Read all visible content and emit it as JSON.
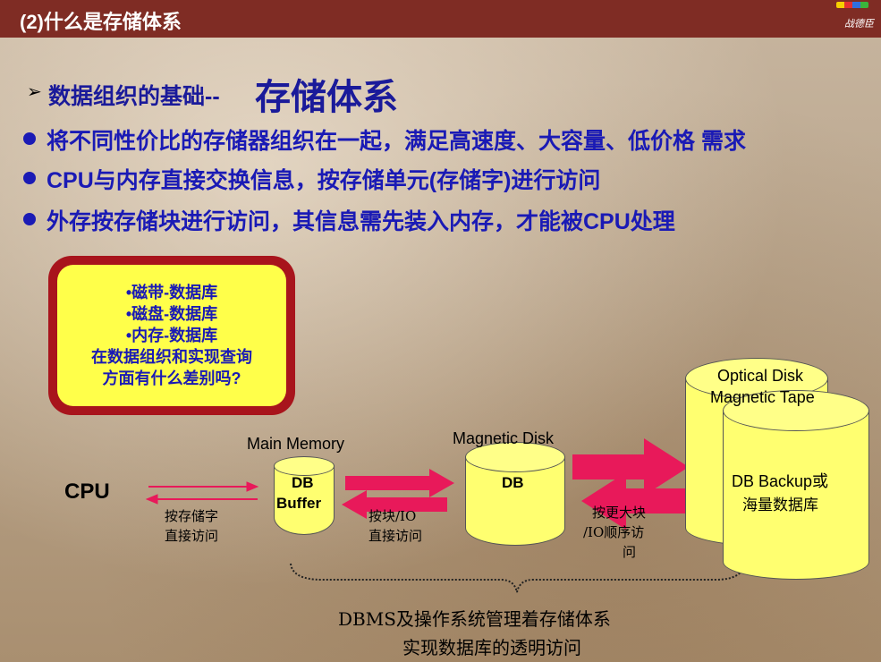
{
  "header": {
    "title": "(2)什么是存储体系",
    "logo_text": "战德臣"
  },
  "subtitle": {
    "prefix": "数据组织的基础--",
    "emphasis": "存储体系"
  },
  "bullets": [
    "将不同性价比的存储器组织在一起，满足高速度、大容量、低价格 需求",
    "CPU与内存直接交换信息，按存储单元(存储字)进行访问",
    "外存按存储块进行访问，其信息需先装入内存，才能被CPU处理"
  ],
  "question_box": {
    "lines": [
      "•磁带-数据库",
      "•磁盘-数据库",
      "•内存-数据库",
      "在数据组织和实现查询",
      "方面有什么差别吗?"
    ]
  },
  "diagram": {
    "cpu": "CPU",
    "main_memory": "Main  Memory",
    "db_buffer_1": "DB",
    "db_buffer_2": "Buffer",
    "magnetic_disk": "Magnetic  Disk",
    "disk_db": "DB",
    "optical_disk": "Optical  Disk",
    "magnetic_tape": "Magnetic Tape",
    "backup_1": "DB  Backup或",
    "backup_2": "海量数据库",
    "access_word_1": "按存储字",
    "access_word_2": "直接访问",
    "access_block_1": "按块/IO",
    "access_block_2": "直接访问",
    "access_large_1": "按更大块",
    "access_large_2": "/IO顺序访",
    "access_large_3": "问",
    "footer_1": "DBMS及操作系统管理着存储体系",
    "footer_2": "实现数据库的透明访问"
  },
  "colors": {
    "header_bg": "#7f2c24",
    "text_blue": "#1a1ab5",
    "box_red": "#a8141c",
    "box_yellow": "#ffff4a",
    "arrow_pink": "#e8195a",
    "cylinder_yellow": "#ffff70"
  }
}
